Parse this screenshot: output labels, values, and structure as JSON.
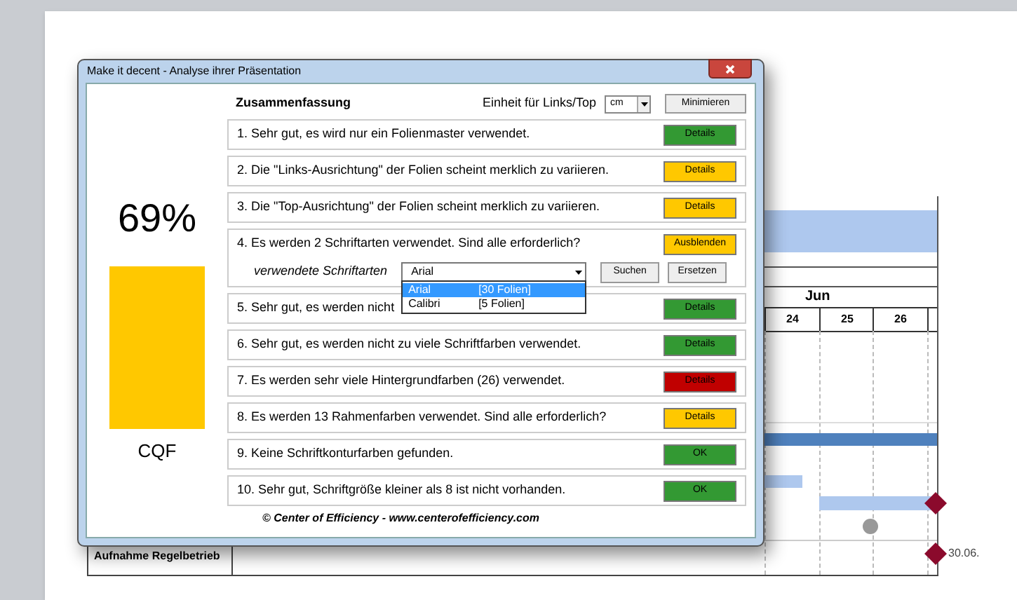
{
  "slide": {
    "month": "Jun",
    "days": [
      "24",
      "25",
      "26"
    ],
    "row_label": "Aufnahme Regelbetrieb",
    "milestone_label": "30.06."
  },
  "dialog": {
    "title": "Make it decent - Analyse ihrer Präsentation",
    "score": "69%",
    "score_label": "CQF",
    "summary_title": "Zusammenfassung",
    "unit_label": "Einheit für Links/Top",
    "unit_value": "cm",
    "minimize_button": "Minimieren",
    "checks": [
      {
        "number": "1.",
        "text": "Sehr gut, es wird nur ein Folienmaster verwendet.",
        "button": "Details",
        "color": "#339933"
      },
      {
        "number": "2.",
        "text": "Die \"Links-Ausrichtung\" der Folien scheint merklich zu variieren.",
        "button": "Details",
        "color": "#ffc800"
      },
      {
        "number": "3.",
        "text": "Die \"Top-Ausrichtung\" der Folien scheint merklich zu variieren.",
        "button": "Details",
        "color": "#ffc800"
      },
      {
        "number": "4.",
        "text": "Es werden 2 Schriftarten verwendet. Sind alle erforderlich?",
        "button": "Ausblenden",
        "color": "#ffc800",
        "expanded": true,
        "fonts": {
          "label": "verwendete Schriftarten",
          "value": "Arial",
          "search_button": "Suchen",
          "replace_button": "Ersetzen",
          "options": [
            {
              "name": "Arial",
              "count": "[30 Folien]",
              "selected": true
            },
            {
              "name": "Calibri",
              "count": "[5 Folien]",
              "selected": false
            }
          ]
        }
      },
      {
        "number": "5.",
        "text": "Sehr gut, es werden nicht",
        "button": "Details",
        "color": "#339933"
      },
      {
        "number": "6.",
        "text": "Sehr gut, es werden nicht zu viele Schriftfarben verwendet.",
        "button": "Details",
        "color": "#339933"
      },
      {
        "number": "7.",
        "text": "Es werden sehr viele Hintergrundfarben (26) verwendet.",
        "button": "Details",
        "color": "#c00000"
      },
      {
        "number": "8.",
        "text": "Es werden 13 Rahmenfarben verwendet. Sind alle erforderlich?",
        "button": "Details",
        "color": "#ffc800"
      },
      {
        "number": "9.",
        "text": "Keine Schriftkonturfarben gefunden.",
        "button": "OK",
        "color": "#339933"
      },
      {
        "number": "10.",
        "text": "Sehr gut, Schriftgröße kleiner als 8 ist nicht vorhanden.",
        "button": "OK",
        "color": "#339933"
      }
    ],
    "footer": "© Center of Efficiency - www.centerofefficiency.com"
  }
}
